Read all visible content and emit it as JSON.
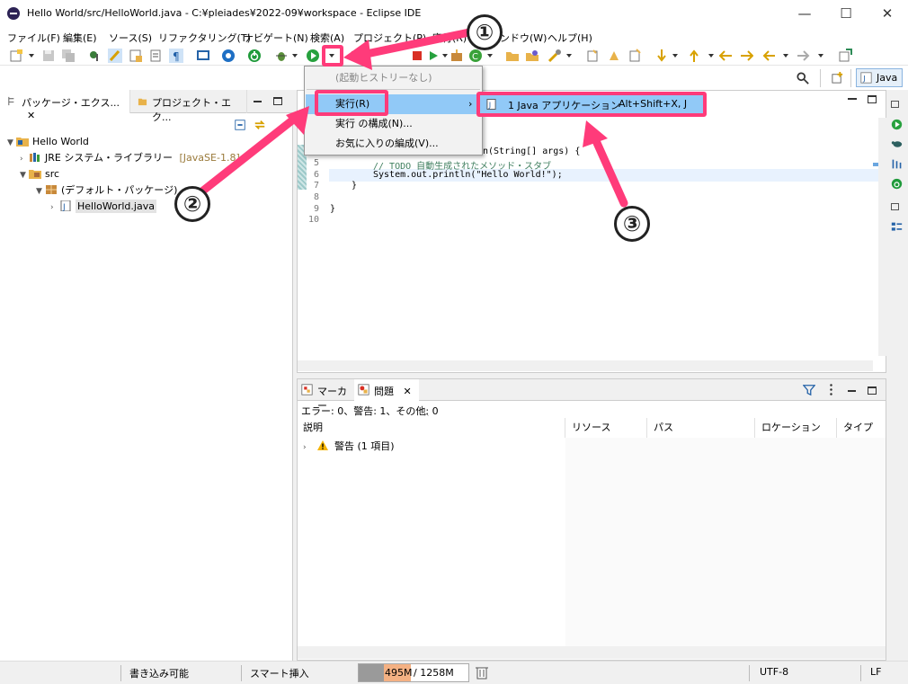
{
  "window": {
    "title": "Hello World/src/HelloWorld.java - C:¥pleiades¥2022-09¥workspace - Eclipse IDE",
    "minimize": "—",
    "maximize": "☐",
    "close": "✕"
  },
  "menubar": [
    "ファイル(F)",
    "編集(E)",
    "ソース(S)",
    "リファクタリング(T)",
    "ナビゲート(N)",
    "検索(A)",
    "プロジェクト(P)",
    "実行(R)",
    "ウィンドウ(W)",
    "ヘルプ(H)"
  ],
  "perspective": {
    "java_label": "Java"
  },
  "left_panel": {
    "tab_package": "パッケージ・エクス...",
    "tab_project": "プロジェクト・エク...",
    "tree": {
      "project": "Hello World",
      "jre": "JRE システム・ライブラリー",
      "jre_version": "[JavaSE-1.8]",
      "src": "src",
      "package": "(デフォルト・パッケージ)",
      "file": "HelloWorld.java"
    }
  },
  "editor": {
    "line_numbers": [
      "5",
      "6",
      "7",
      "8",
      "9",
      "10"
    ],
    "code_line4_tail": "n(String[] args) {",
    "code_line5": "// TODO 自動生成されたメソッド・スタブ",
    "code_line6": "System.out.println(\"Hello World!\");",
    "code_line7": "}",
    "code_line9": "}"
  },
  "dropdown": {
    "no_history": "(起動ヒストリーなし)",
    "run": "実行(R)",
    "run_config": "実行 の構成(N)...",
    "favorites": "お気に入りの編成(V)...",
    "submenu_item": "1 Java アプリケーション",
    "submenu_shortcut": "Alt+Shift+X, J"
  },
  "bottom_panel": {
    "tab_markers": "マーカー",
    "tab_problems": "問題",
    "summary": "エラー: 0、警告: 1、その他: 0",
    "columns": [
      "説明",
      "リソース",
      "パス",
      "ロケーション",
      "タイプ"
    ],
    "warning_row": "警告 (1 項目)"
  },
  "statusbar": {
    "writable": "書き込み可能",
    "insert_mode": "スマート挿入",
    "heap_used": "495M",
    "heap_total": "/ 1258M",
    "encoding": "UTF-8",
    "line_ending": "LF"
  },
  "annotations": {
    "one": "①",
    "two": "②",
    "three": "③"
  },
  "colors": {
    "accent_pink": "#ff3b7a",
    "selection_blue": "#91c9f7",
    "heap_orange": "#f4b183"
  }
}
